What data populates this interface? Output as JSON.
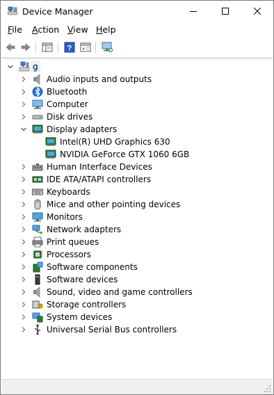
{
  "window": {
    "title": "Device Manager"
  },
  "menu": [
    "File",
    "Action",
    "View",
    "Help"
  ],
  "menu_accel": [
    "F",
    "A",
    "V",
    "H"
  ],
  "toolbar": [
    "back-icon",
    "forward-icon",
    "show-hide-console-tree-icon",
    "help-icon",
    "properties-icon",
    "scan-hardware-icon"
  ],
  "tree": {
    "root": {
      "label": "g",
      "expanded": true
    },
    "items": [
      {
        "label": "Audio inputs and outputs",
        "icon": "speaker-icon",
        "expanded": false
      },
      {
        "label": "Bluetooth",
        "icon": "bluetooth-icon",
        "expanded": false
      },
      {
        "label": "Computer",
        "icon": "computer-icon",
        "expanded": false
      },
      {
        "label": "Disk drives",
        "icon": "disk-drive-icon",
        "expanded": false
      },
      {
        "label": "Display adapters",
        "icon": "display-adapter-icon",
        "expanded": true,
        "children": [
          {
            "label": "Intel(R) UHD Graphics 630",
            "icon": "display-adapter-icon"
          },
          {
            "label": "NVIDIA GeForce GTX 1060 6GB",
            "icon": "display-adapter-icon"
          }
        ]
      },
      {
        "label": "Human Interface Devices",
        "icon": "hid-icon",
        "expanded": false
      },
      {
        "label": "IDE ATA/ATAPI controllers",
        "icon": "ide-controller-icon",
        "expanded": false
      },
      {
        "label": "Keyboards",
        "icon": "keyboard-icon",
        "expanded": false
      },
      {
        "label": "Mice and other pointing devices",
        "icon": "mouse-icon",
        "expanded": false
      },
      {
        "label": "Monitors",
        "icon": "monitor-icon",
        "expanded": false
      },
      {
        "label": "Network adapters",
        "icon": "network-adapter-icon",
        "expanded": false
      },
      {
        "label": "Print queues",
        "icon": "printer-icon",
        "expanded": false
      },
      {
        "label": "Processors",
        "icon": "processor-icon",
        "expanded": false
      },
      {
        "label": "Software components",
        "icon": "software-component-icon",
        "expanded": false
      },
      {
        "label": "Software devices",
        "icon": "software-device-icon",
        "expanded": false
      },
      {
        "label": "Sound, video and game controllers",
        "icon": "sound-icon",
        "expanded": false
      },
      {
        "label": "Storage controllers",
        "icon": "storage-controller-icon",
        "expanded": false
      },
      {
        "label": "System devices",
        "icon": "system-device-icon",
        "expanded": false
      },
      {
        "label": "Universal Serial Bus controllers",
        "icon": "usb-icon",
        "expanded": false
      }
    ]
  },
  "colors": {
    "selection": "#e5f3ff",
    "accent_blue": "#1f7ad6",
    "border": "#7a7a7a",
    "statusbar": "#f0f0f0"
  }
}
